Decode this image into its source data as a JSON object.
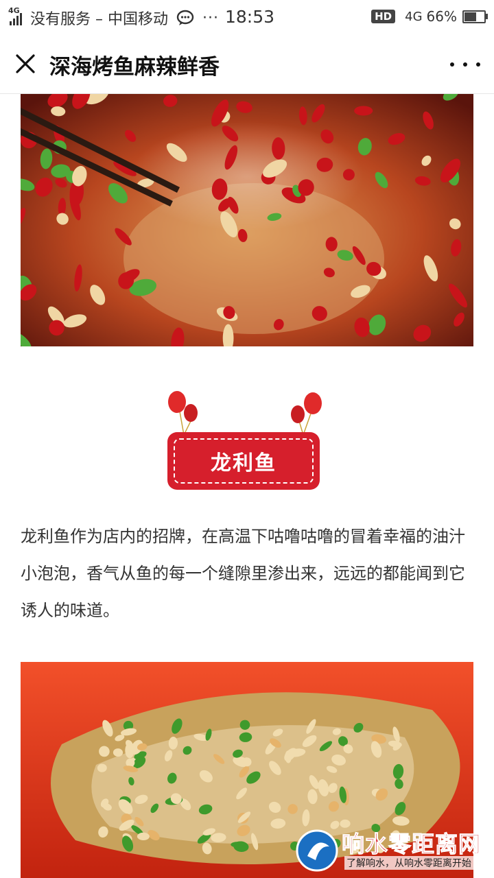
{
  "status_bar": {
    "network_badge": "4G",
    "carrier": "没有服务 – 中国移动",
    "dots": "···",
    "time": "18:53",
    "hd": "HD",
    "network": "4G",
    "battery_text": "66%",
    "battery_level": 0.66
  },
  "header": {
    "title": "深海烤鱼麻辣鲜香"
  },
  "section": {
    "label": "龙利鱼",
    "description": "龙利鱼作为店内的招牌，在高温下咕噜咕噜的冒着幸福的油汁小泡泡，香气从鱼的每一个缝隙里渗出来，远远的都能闻到它诱人的味道。"
  },
  "watermark": {
    "brand": "响水零距离网",
    "slogan": "了解响水，从响水零距离开始"
  },
  "colors": {
    "badge_red": "#d61f2c",
    "balloon_red": "#e02a2a"
  }
}
